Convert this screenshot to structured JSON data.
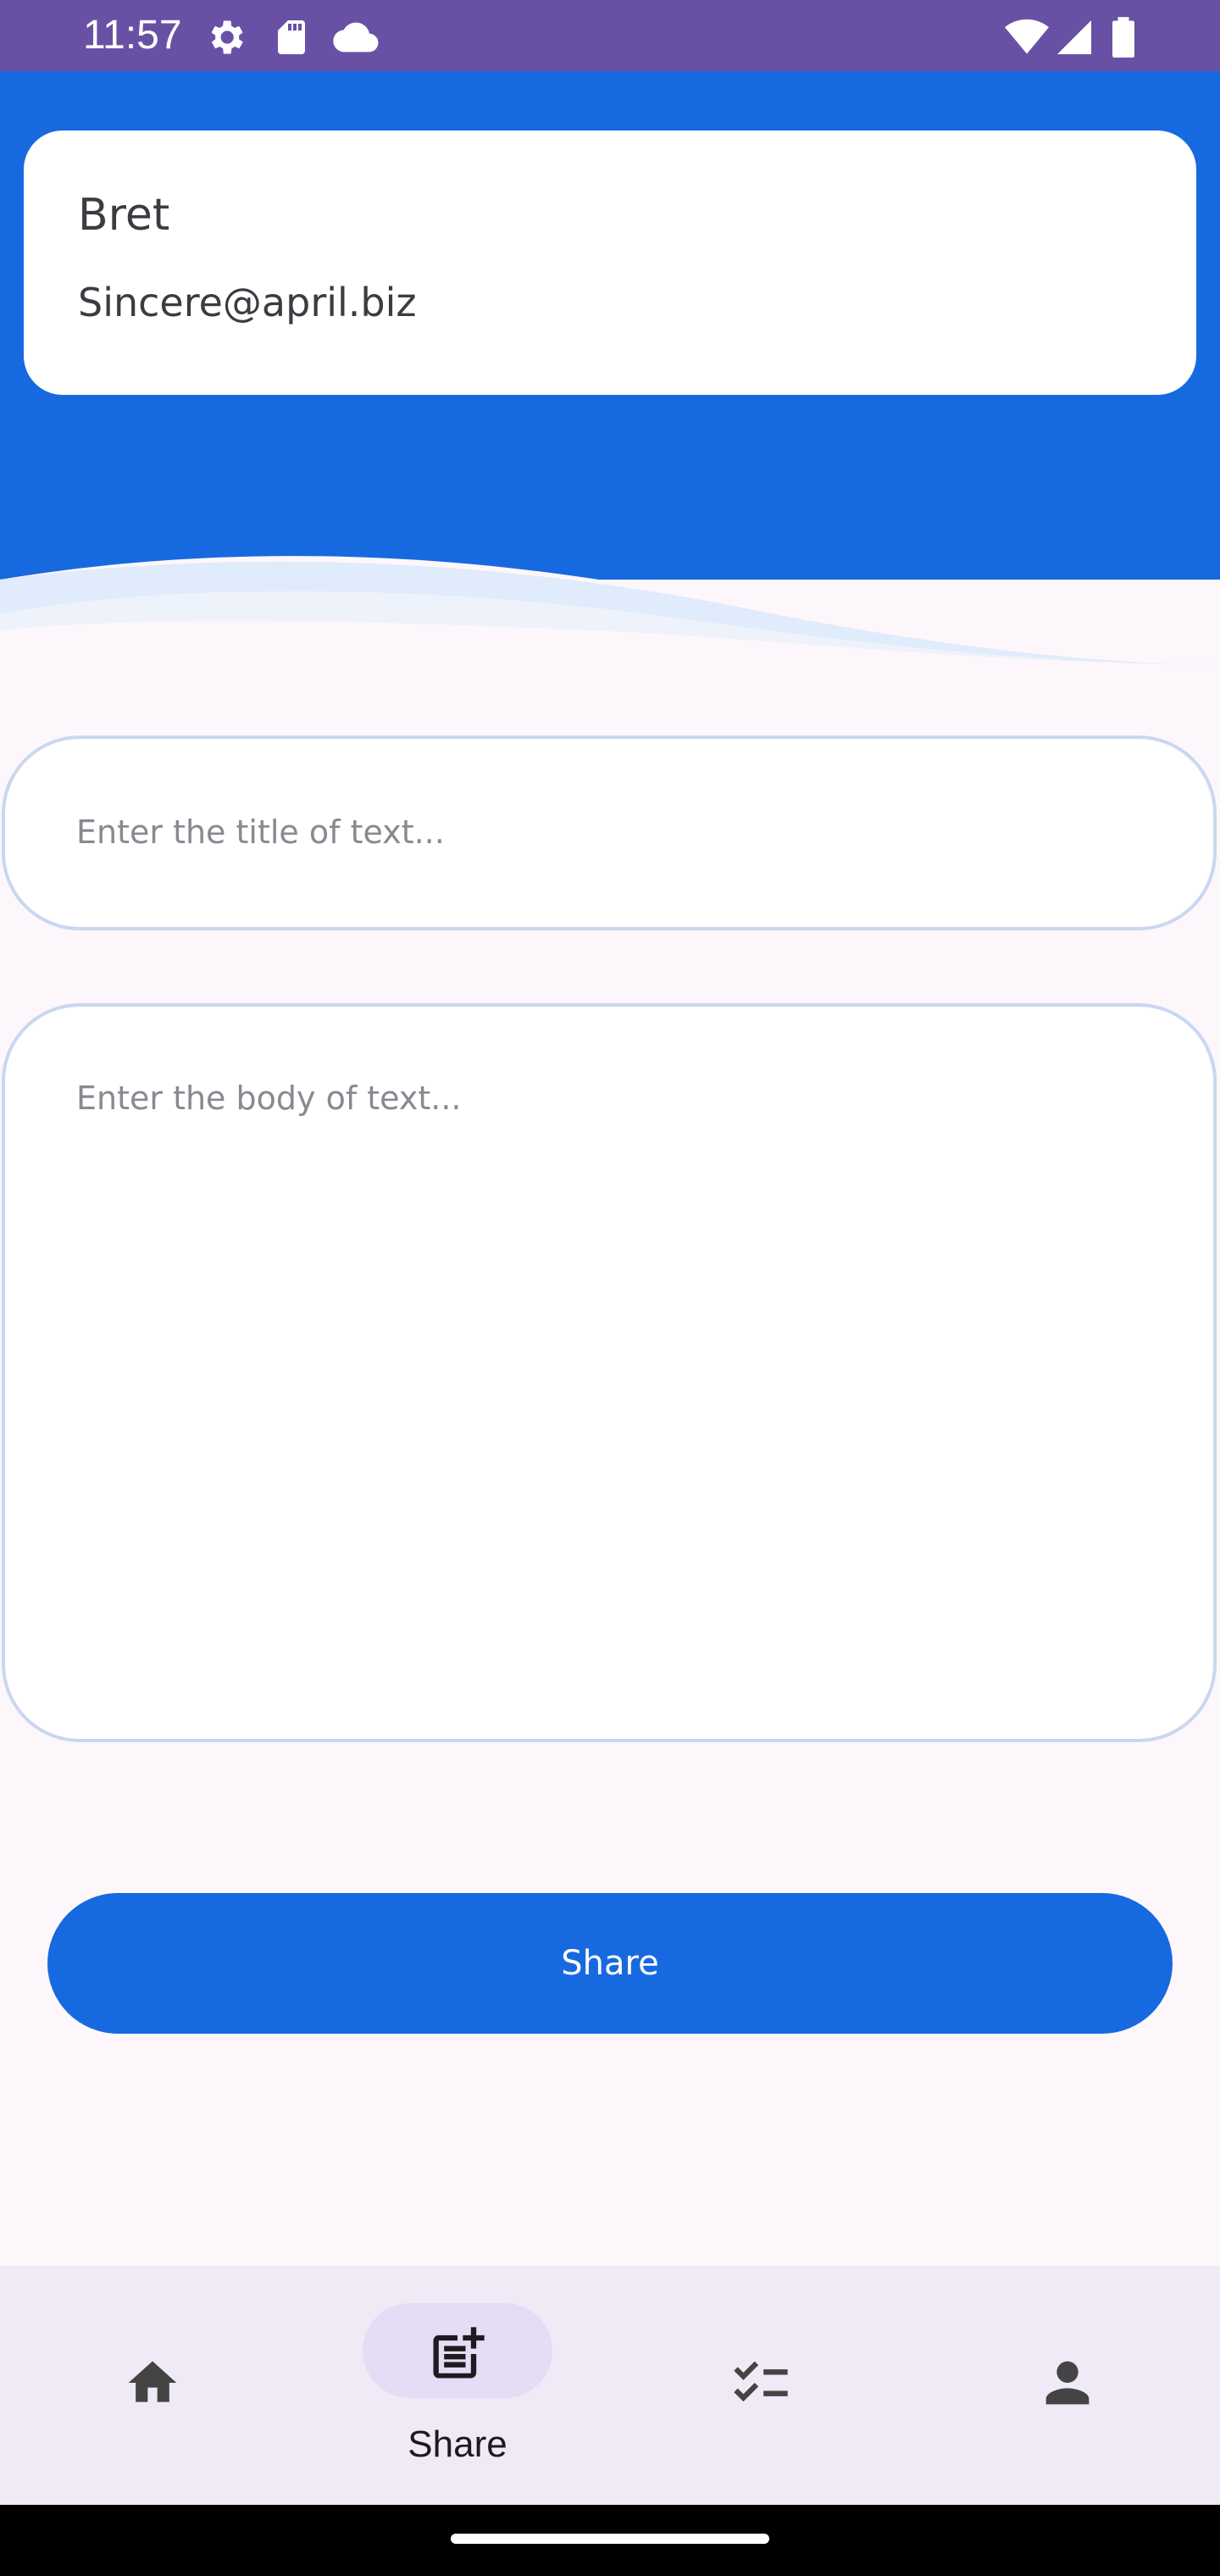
{
  "status_bar": {
    "time": "11:57",
    "icons": [
      "settings-icon",
      "sd-card-icon",
      "cloud-icon",
      "wifi-icon",
      "signal-icon",
      "battery-icon"
    ]
  },
  "user": {
    "name": "Bret",
    "email": "Sincere@april.biz"
  },
  "form": {
    "title_placeholder": "Enter the title of text...",
    "body_placeholder": "Enter the body of text...",
    "share_label": "Share"
  },
  "nav": {
    "items": [
      {
        "icon": "home-icon",
        "label": ""
      },
      {
        "icon": "post-add-icon",
        "label": "Share",
        "selected": true
      },
      {
        "icon": "checklist-icon",
        "label": ""
      },
      {
        "icon": "person-icon",
        "label": ""
      }
    ]
  },
  "colors": {
    "status_bar": "#6851a5",
    "primary": "#1769e0",
    "background": "#fdf7fc",
    "nav_background": "#f0eaf6",
    "nav_selected_pill": "#e5dcf6"
  }
}
